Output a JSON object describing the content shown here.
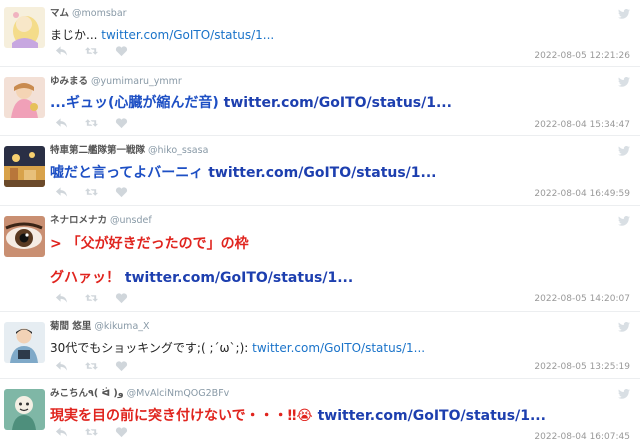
{
  "tweets": [
    {
      "name": "マム",
      "handle": "@momsbar",
      "text_plain": "まじか... ",
      "link": "twitter.com/GoITO/status/1...",
      "timestamp": "2022-08-05 12:21:26"
    },
    {
      "name": "ゆみまる",
      "handle": "@yumimaru_ymmr",
      "text_plain": "...ギュッ(心臓が縮んだ音) ",
      "link": "twitter.com/GoITO/status/1...",
      "timestamp": "2022-08-04 15:34:47"
    },
    {
      "name": "特車第二艦隊第一戦隊",
      "handle": "@hiko_ssasa",
      "text_plain": "嘘だと言ってよバーニィ ",
      "link": "twitter.com/GoITO/status/1...",
      "timestamp": "2022-08-04 16:49:59"
    },
    {
      "name": "ネナロメナカ",
      "handle": "@unsdef",
      "text_line1": "> 「父が好きだったので」の枠",
      "text_line2": "グハァッ！ ",
      "link": "twitter.com/GoITO/status/1...",
      "timestamp": "2022-08-05 14:20:07"
    },
    {
      "name": "菊間 悠里",
      "handle": "@kikuma_X",
      "text_plain": "30代でもショッキングです;( ;´ω`;): ",
      "link": "twitter.com/GoITO/status/1...",
      "timestamp": "2022-08-05 13:25:19"
    },
    {
      "name": "みこちん٩( ᐛ )و",
      "handle": "@MvAlciNmQOG2BFv",
      "text_plain": "現実を目の前に突き付けないで・・・‼😭 ",
      "link": "twitter.com/GoITO/status/1...",
      "timestamp": "2022-08-04 16:07:45"
    }
  ],
  "icons": {
    "reply": "reply-icon",
    "retweet": "retweet-icon",
    "like": "heart-icon",
    "bird": "twitter-bird-icon"
  },
  "colors": {
    "link": "#1a73c9",
    "big_link": "#1d3faf",
    "red_text": "#e0241e",
    "blue_text": "#1d4fc4",
    "timestamp": "#999999",
    "icon": "#d0d6db"
  }
}
